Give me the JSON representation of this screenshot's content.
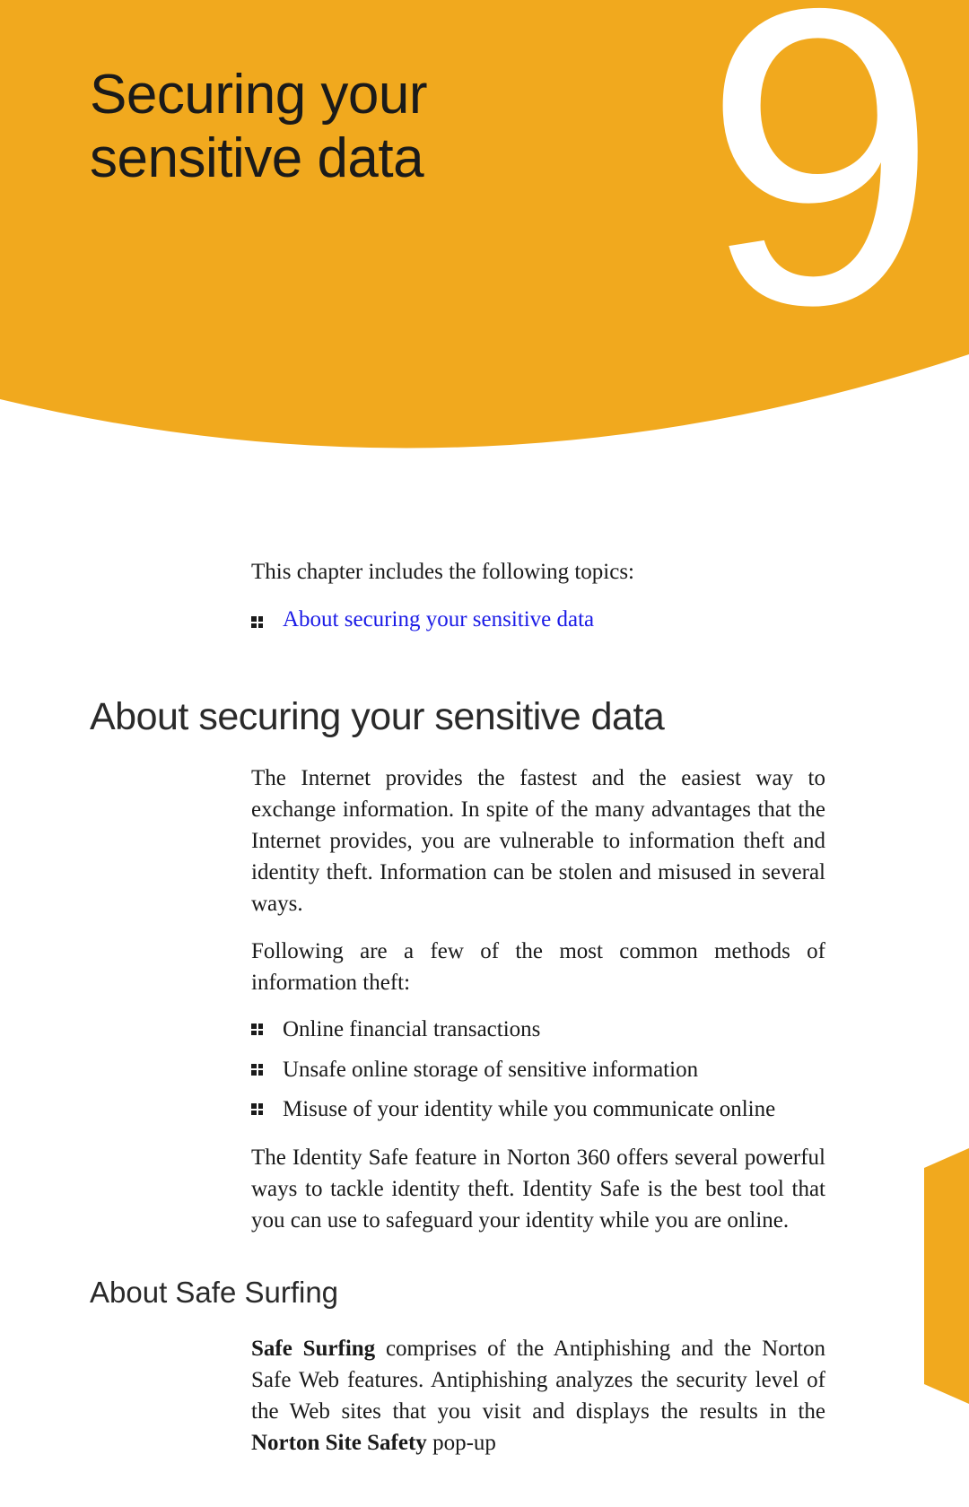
{
  "chapter": {
    "title_line1": "Securing your",
    "title_line2": "sensitive data",
    "number": "9"
  },
  "intro": "This chapter includes the following topics:",
  "topics": [
    {
      "label": "About securing your sensitive data"
    }
  ],
  "section": {
    "heading": "About securing your sensitive data",
    "para1": "The Internet provides the fastest and the easiest way to exchange information. In spite of the many advantages that the Internet provides, you are vulnerable to information theft and identity theft. Information can be stolen and misused in several ways.",
    "para2": "Following are a few of the most common methods of information theft:",
    "theft_list": [
      "Online financial transactions",
      "Unsafe online storage of sensitive information",
      "Misuse of your identity while you communicate online"
    ],
    "para3": "The Identity Safe feature in Norton 360 offers several powerful ways to tackle identity theft. Identity Safe is the best tool that you can use to safeguard your identity while you are online."
  },
  "subsection": {
    "heading": "About Safe Surfing",
    "para_prefix_bold": "Safe Surfing",
    "para_mid": " comprises of the Antiphishing and the Norton Safe Web features. Antiphishing analyzes the security level of the Web sites that you visit and displays the results in the ",
    "para_bold2": "Norton Site Safety",
    "para_suffix": " pop-up"
  },
  "colors": {
    "accent": "#f1a91e",
    "link": "#1a1ae6"
  }
}
